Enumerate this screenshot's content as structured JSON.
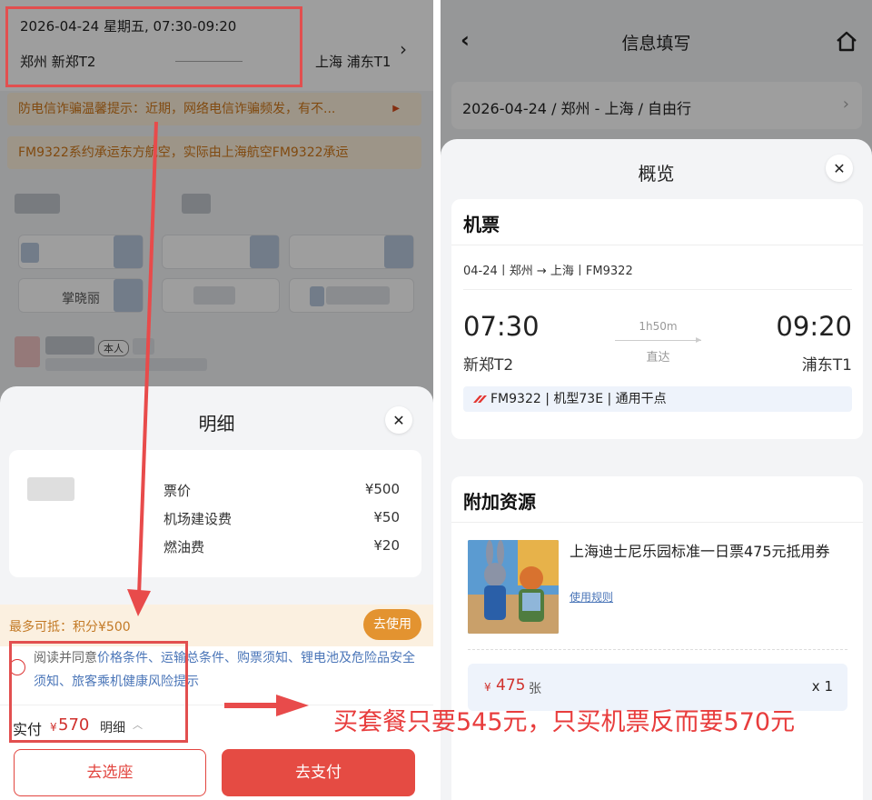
{
  "left": {
    "header": {
      "date_time": "2026-04-24 星期五, 07:30-09:20",
      "from": "郑州  新郑T2",
      "to": "上海  浦东T1"
    },
    "notices": [
      "防电信诈骗温馨提示：近期，网络电信诈骗频发，有不...",
      "FM9322系约承运东方航空，实际由上海航空FM9322承运"
    ],
    "passenger": {
      "name": "掌晓丽",
      "self_tag": "本人"
    },
    "sheet": {
      "title": "明细",
      "fees": [
        {
          "label": "票价",
          "value": "¥500"
        },
        {
          "label": "机场建设费",
          "value": "¥50"
        },
        {
          "label": "燃油费",
          "value": "¥20"
        }
      ],
      "deduct_text": "最多可抵：积分¥500",
      "use_button": "去使用",
      "agree_prefix": "阅读并同意",
      "agree_links": "价格条件、运输总条件、购票须知、锂电池及危险品安全须知、旅客乘机健康风险提示",
      "total_label": "实付",
      "total_currency": "¥",
      "total_value": "570",
      "detail_label": "明细",
      "seat_button": "去选座",
      "pay_button": "去支付"
    }
  },
  "right": {
    "topbar": {
      "title": "信息填写"
    },
    "trip_summary": "2026-04-24 / 郑州 - 上海 / 自由行",
    "sheet": {
      "title": "概览",
      "ticket": {
        "title": "机票",
        "route": "04-24丨郑州 → 上海丨FM9322",
        "depart_time": "07:30",
        "arrive_time": "09:20",
        "duration": "1h50m",
        "direct": "直达",
        "depart_airport": "新郑T2",
        "arrive_airport": "浦东T1",
        "flight_info": "FM9322 | 机型73E | 通用干点"
      },
      "addon": {
        "title": "附加资源",
        "name": "上海迪士尼乐园标准一日票475元抵用券",
        "rule_link": "使用规则",
        "currency": "¥",
        "price": "475",
        "unit": "张",
        "qty": "x 1"
      }
    }
  },
  "annotation": "买套餐只要545元，只买机票反而要570元",
  "colors": {
    "accent_red": "#e54b43",
    "annotation_red": "#e83d3d",
    "orange": "#e39330",
    "link_blue": "#4b76b8"
  }
}
